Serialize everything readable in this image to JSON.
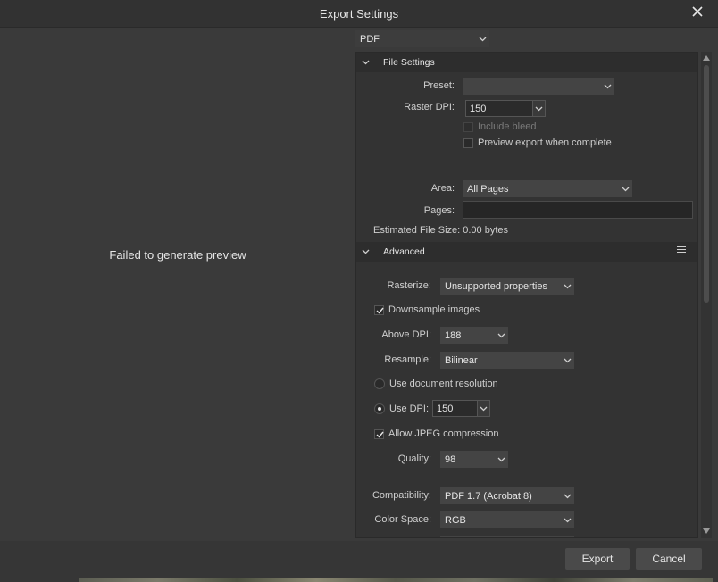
{
  "window": {
    "title": "Export Settings"
  },
  "preview": {
    "message": "Failed to generate preview"
  },
  "format": {
    "value": "PDF"
  },
  "file_settings": {
    "header": "File Settings",
    "preset_label": "Preset:",
    "preset_value": "",
    "raster_dpi_label": "Raster DPI:",
    "raster_dpi_value": "150",
    "include_bleed_label": "Include bleed",
    "include_bleed_checked": false,
    "include_bleed_disabled": true,
    "preview_export_label": "Preview export when complete",
    "preview_export_checked": false,
    "area_label": "Area:",
    "area_value": "All Pages",
    "pages_label": "Pages:",
    "pages_value": "",
    "estimated_size": "Estimated File Size: 0.00 bytes"
  },
  "advanced": {
    "header": "Advanced",
    "rasterize_label": "Rasterize:",
    "rasterize_value": "Unsupported properties",
    "downsample_label": "Downsample images",
    "downsample_checked": true,
    "above_dpi_label": "Above DPI:",
    "above_dpi_value": "188",
    "resample_label": "Resample:",
    "resample_value": "Bilinear",
    "use_doc_res_label": "Use document resolution",
    "use_dpi_label": "Use DPI:",
    "use_dpi_value": "150",
    "resolution_mode": "Use DPI",
    "jpeg_label": "Allow JPEG compression",
    "jpeg_checked": true,
    "quality_label": "Quality:",
    "quality_value": "98",
    "compat_label": "Compatibility:",
    "compat_value": "PDF 1.7 (Acrobat 8)",
    "color_space_label": "Color Space:",
    "color_space_value": "RGB"
  },
  "buttons": {
    "export": "Export",
    "cancel": "Cancel"
  },
  "icons": {
    "close": "close-icon",
    "collapse": "chevron-down-icon",
    "menu": "hamburger-menu-icon",
    "check": "checkmark-icon"
  },
  "colors": {
    "background": "#3a3a3a",
    "panel": "#333333",
    "section_header": "#2d2d2d",
    "text": "#e6e6e6"
  }
}
